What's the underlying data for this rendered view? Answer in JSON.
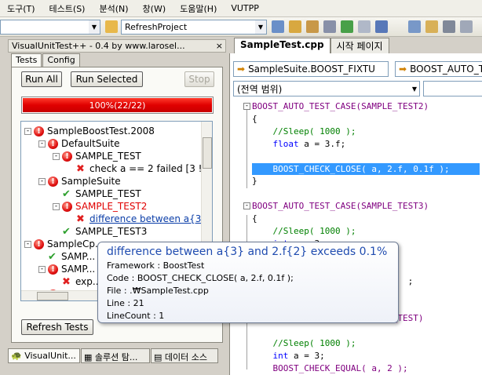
{
  "menu": [
    "도구(T)",
    "테스트(S)",
    "분석(N)",
    "창(W)",
    "도움말(H)",
    "VUTPP"
  ],
  "toolbar": {
    "project_combo": "RefreshProject"
  },
  "panel": {
    "title": "VisualUnitTest++ - 0.4 by www.larosel...",
    "close": "×",
    "tabs": [
      "Tests",
      "Config"
    ],
    "buttons": {
      "run_all": "Run All",
      "run_selected": "Run Selected",
      "stop": "Stop",
      "refresh": "Refresh Tests"
    },
    "progress": {
      "text": "100%(22/22)",
      "fraction": 1.0,
      "color": "#e00000"
    },
    "tree": [
      {
        "text": "SampleBoostTest.2008",
        "status": "fail",
        "level": 0,
        "exp": "-"
      },
      {
        "text": "DefaultSuite",
        "status": "fail",
        "level": 1,
        "exp": "-"
      },
      {
        "text": "SAMPLE_TEST",
        "status": "fail",
        "level": 2,
        "exp": "-"
      },
      {
        "text": "check a == 2 failed [3 !",
        "status": "x",
        "level": 3,
        "exp": ""
      },
      {
        "text": "SampleSuite",
        "status": "fail",
        "level": 1,
        "exp": "-"
      },
      {
        "text": "SAMPLE_TEST",
        "status": "pass",
        "level": 2,
        "exp": ""
      },
      {
        "text": "SAMPLE_TEST2",
        "status": "fail",
        "level": 2,
        "exp": "-",
        "style": "red"
      },
      {
        "text": "difference between a{3",
        "status": "x",
        "level": 3,
        "exp": "",
        "style": "link"
      },
      {
        "text": "SAMPLE_TEST3",
        "status": "pass",
        "level": 2,
        "exp": ""
      },
      {
        "text": "SampleCp...",
        "status": "fail",
        "level": 0,
        "exp": "-"
      },
      {
        "text": "SAMP...",
        "status": "pass",
        "level": 1,
        "exp": ""
      },
      {
        "text": "SAMP...",
        "status": "fail",
        "level": 1,
        "exp": "-"
      },
      {
        "text": "exp...",
        "status": "x",
        "level": 2,
        "exp": ""
      },
      {
        "text": "SAMP...",
        "status": "fail",
        "level": 1,
        "exp": ""
      }
    ],
    "bottom_tabs": [
      "VisualUnit...",
      "솔루션 탐...",
      "데이터 소스"
    ]
  },
  "editor": {
    "tabs": [
      "SampleTest.cpp",
      "시작 페이지"
    ],
    "nav": {
      "left": "SampleSuite.BOOST_FIXTU",
      "right": "BOOST_AUTO_TE",
      "scope": "(전역 범위)"
    },
    "code": [
      {
        "text": "BOOST_AUTO_TEST_CASE(SAMPLE_TEST2)",
        "cls": "mac",
        "fold": "-"
      },
      {
        "text": "{",
        "cls": ""
      },
      {
        "text": "    //Sleep( 1000 );",
        "cls": "cm"
      },
      {
        "text": "    float a = 3.f;",
        "cls": "mix_float"
      },
      {
        "text": "",
        "cls": ""
      },
      {
        "text": "    BOOST_CHECK_CLOSE( a, 2.f, 0.1f );",
        "cls": "hl"
      },
      {
        "text": "}",
        "cls": ""
      },
      {
        "text": "",
        "cls": ""
      },
      {
        "text": "BOOST_AUTO_TEST_CASE(SAMPLE_TEST3)",
        "cls": "mac",
        "fold": "-"
      },
      {
        "text": "{",
        "cls": ""
      },
      {
        "text": "    //Sleep( 1000 );",
        "cls": "cm"
      },
      {
        "text": "    int a = 3;",
        "cls": "mix_int"
      },
      {
        "text": "",
        "cls": ""
      },
      {
        "text": "",
        "cls": ""
      },
      {
        "text": "                              ;",
        "cls": ""
      },
      {
        "text": "",
        "cls": ""
      },
      {
        "text": "",
        "cls": ""
      },
      {
        "text": "                           _TEST)",
        "cls": "mac",
        "fold": "-"
      },
      {
        "text": "",
        "cls": ""
      },
      {
        "text": "    //Sleep( 1000 );",
        "cls": "cm"
      },
      {
        "text": "    int a = 3;",
        "cls": "mix_int"
      },
      {
        "text": "    BOOST_CHECK_EQUAL( a, 2 );",
        "cls": "mac"
      }
    ]
  },
  "tooltip": {
    "title": "difference between a{3} and 2.f{2} exceeds 0.1%",
    "lines": [
      "Framework : BoostTest",
      "Code : BOOST_CHECK_CLOSE( a, 2.f, 0.1f );",
      "File : .₩SampleTest.cpp",
      "Line : 21",
      "LineCount : 1"
    ]
  }
}
